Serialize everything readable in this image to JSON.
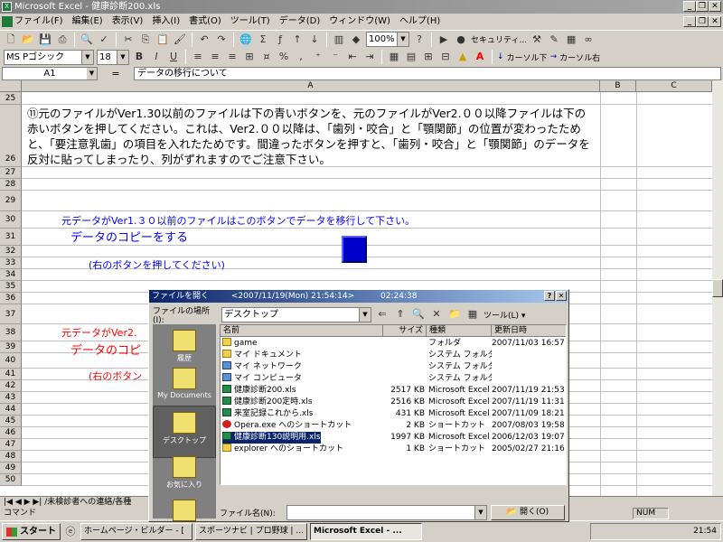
{
  "window": {
    "title": "Microsoft Excel - 健康診断200.xls",
    "min": "_",
    "restore": "❐",
    "close": "✕"
  },
  "menu": [
    "ファイル(F)",
    "編集(E)",
    "表示(V)",
    "挿入(I)",
    "書式(O)",
    "ツール(T)",
    "データ(D)",
    "ウィンドウ(W)",
    "ヘルプ(H)"
  ],
  "toolbar": {
    "zoom": "100%",
    "security": "セキュリティ...",
    "font_name": "MS Pゴシック",
    "font_size": "18",
    "bold": "B",
    "italic": "I",
    "underline": "U",
    "cursor_down": "カーソル下",
    "cursor_right": "カーソル右"
  },
  "formula": {
    "name_box": "A1",
    "equals": "=",
    "content": "データの移行について"
  },
  "columns": [
    "A",
    "B",
    "C"
  ],
  "rows": [
    "25",
    "26",
    "27",
    "28",
    "29",
    "30",
    "31",
    "32",
    "33",
    "34",
    "35",
    "36",
    "37",
    "38",
    "39",
    "40",
    "41",
    "42",
    "43",
    "44",
    "45",
    "46",
    "47",
    "48",
    "49",
    "50"
  ],
  "cells": {
    "r26_text": "⑪元のファイルがVer1.30以前のファイルは下の青いボタンを、元のファイルがVer2.００以降ファイルは下の赤いボタンを押してください。これは、Ver2.００以降は、「歯列・咬合」と「顎関節」の位置が変わったためと、「要注意乳歯」の項目を入れたためです。間違ったボタンを押すと、「歯列・咬合」と「顎関節」のデータを反対に貼ってしまったり、列がずれますのでご注意下さい。",
    "r30_text": "元データがVer1.３０以前のファイルはこのボタンでデータを移行して下さい。",
    "r31_text": "データのコピーをする",
    "r33_text": "(右のボタンを押してください)",
    "r38_text": "元データがVer2.",
    "r39_text": "データのコピ",
    "r41_text": "(右のボタン"
  },
  "colors": {
    "blue_text": "#0000ff",
    "red_text": "#ff0000",
    "button_blue": "#0000cc"
  },
  "sheet_tabs": "|◀ ◀ ▶ ▶| /未検診者への連絡/各種",
  "status": {
    "mode": "コマンド",
    "num": "NUM"
  },
  "dialog": {
    "title": "ファイルを開く",
    "title_time": "<2007/11/19(Mon) 21:54:14>",
    "title_clock": "02:24:38",
    "help_btn": "?",
    "close_btn": "✕",
    "location_label": "ファイルの場所(I):",
    "location_value": "デスクトップ",
    "tools_label": "ツール(L) ▾",
    "places": [
      "履歴",
      "My Documents",
      "デスクトップ",
      "お気に入り",
      ""
    ],
    "headers": [
      "名前",
      "サイズ",
      "種類",
      "更新日時"
    ],
    "files": [
      {
        "name": "game",
        "size": "",
        "type": "フォルダ",
        "date": "2007/11/03 16:57",
        "icon": "folder"
      },
      {
        "name": "マイ ドキュメント",
        "size": "",
        "type": "システム フォルダ",
        "date": "",
        "icon": "folder"
      },
      {
        "name": "マイ ネットワーク",
        "size": "",
        "type": "システム フォルダ",
        "date": "",
        "icon": "sys"
      },
      {
        "name": "マイ コンピュータ",
        "size": "",
        "type": "システム フォルダ",
        "date": "",
        "icon": "sys"
      },
      {
        "name": "健康診断200.xls",
        "size": "2517 KB",
        "type": "Microsoft Excel ...",
        "date": "2007/11/19 21:53",
        "icon": "xls"
      },
      {
        "name": "健康診断200定時.xls",
        "size": "2516 KB",
        "type": "Microsoft Excel ...",
        "date": "2007/11/19 11:31",
        "icon": "xls"
      },
      {
        "name": "来室記録これから.xls",
        "size": "431 KB",
        "type": "Microsoft Excel ...",
        "date": "2007/11/09 18:21",
        "icon": "xls"
      },
      {
        "name": "Opera.exe へのショートカット",
        "size": "2 KB",
        "type": "ショートカット",
        "date": "2007/08/03 19:58",
        "icon": "opera"
      },
      {
        "name": "健康診断130説明用.xls",
        "size": "1997 KB",
        "type": "Microsoft Excel ...",
        "date": "2006/12/03 19:07",
        "icon": "xls",
        "selected": true
      },
      {
        "name": "explorer へのショートカット",
        "size": "1 KB",
        "type": "ショートカット",
        "date": "2005/02/27 21:16",
        "icon": "folder"
      }
    ],
    "filename_label": "ファイル名(N):",
    "filename_value": "",
    "open_btn": "開く(O)"
  },
  "taskbar": {
    "start": "スタート",
    "items": [
      "ホームページ・ビルダー - [",
      "スポーツナビ | プロ野球 | ...",
      "Microsoft Excel - ..."
    ],
    "clock": "21:54"
  }
}
